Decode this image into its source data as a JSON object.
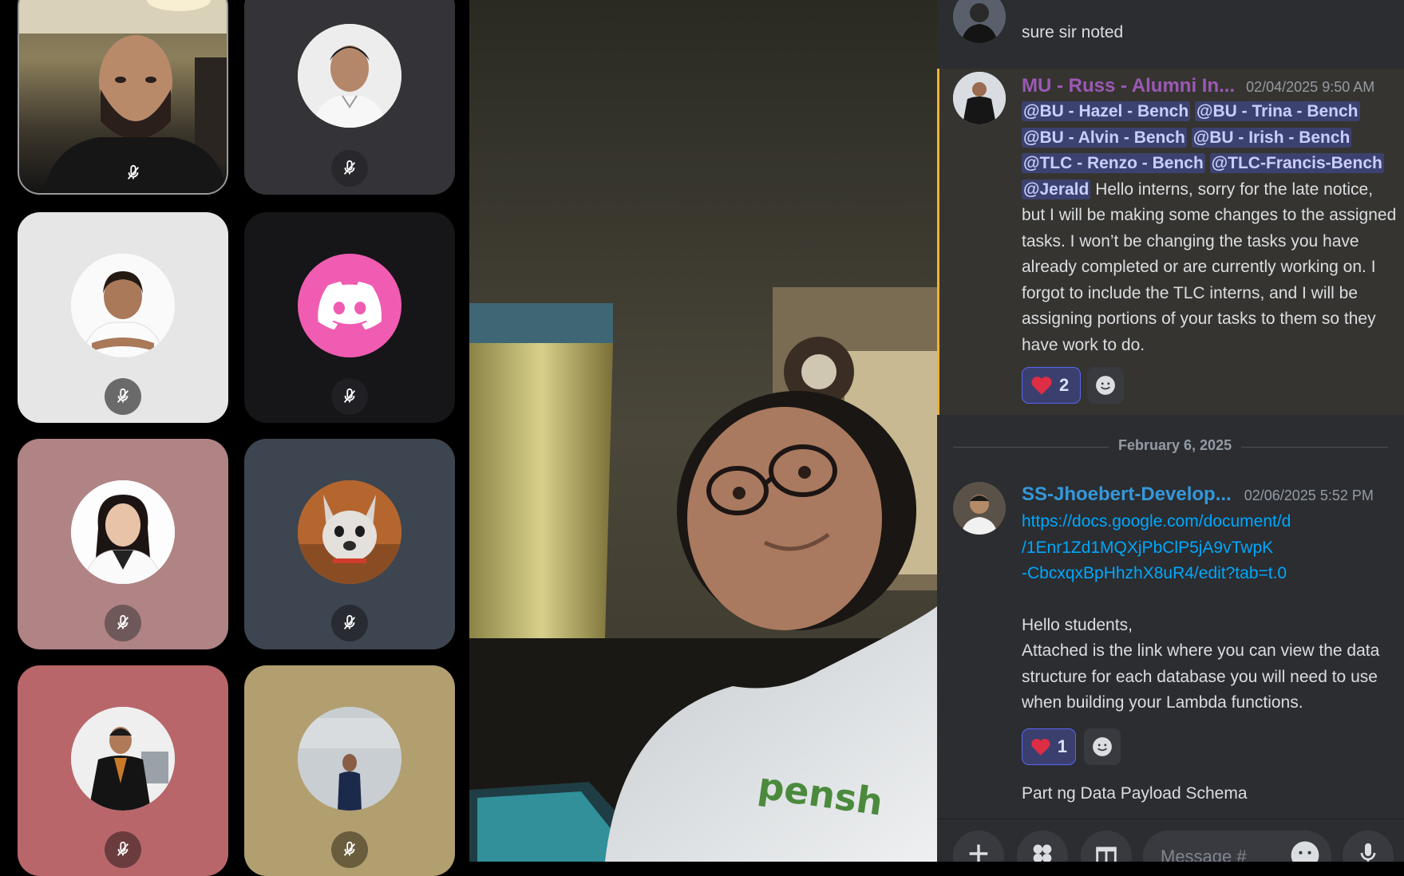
{
  "participants": [
    {
      "id": "p1",
      "muted": true
    },
    {
      "id": "p2",
      "muted": true
    },
    {
      "id": "p3",
      "muted": true
    },
    {
      "id": "p4",
      "muted": true
    },
    {
      "id": "p5",
      "muted": true
    },
    {
      "id": "p6",
      "muted": true
    },
    {
      "id": "p7",
      "muted": true
    },
    {
      "id": "p8",
      "muted": true
    }
  ],
  "colors": {
    "mention_bg": "#3c4270",
    "link": "#00a8fc",
    "author_russ": "#9b59b6",
    "author_jhoebert": "#3498db",
    "heart": "#dd2e44",
    "tile_pink": "#f05cb2"
  },
  "chat": {
    "prev_message": "sure sir noted",
    "msg1": {
      "author": "MU - Russ - Alumni In...",
      "timestamp": "02/04/2025 9:50 AM",
      "mentions": [
        "@BU - Hazel - Bench",
        "@BU - Trina - Bench",
        "@BU - Alvin - Bench",
        "@BU - Irish - Bench",
        "@TLC - Renzo - Bench",
        "@TLC-Francis-Bench",
        "@Jerald"
      ],
      "body": "Hello interns, sorry for the late notice, but I will be making some changes to the assigned tasks. I won’t be changing the tasks you have already completed or are currently working on. I forgot to include the TLC interns, and I will be assigning portions of your tasks to them so they have work to do.",
      "reaction_count": "2"
    },
    "date_divider": "February 6, 2025",
    "msg2": {
      "author": "SS-Jhoebert-Develop...",
      "timestamp": "02/06/2025 5:52 PM",
      "link_lines": [
        "https://docs.google.com/document/d",
        "/1Enr1Zd1MQXjPbClP5jA9vTwpK",
        "-CbcxqxBpHhzhX8uR4/edit?tab=t.0"
      ],
      "greeting": "Hello students,",
      "body": "Attached is the link where you can view the data structure for each database you will need to use when building your Lambda functions.",
      "reaction_count": "1"
    },
    "partial_message": "Part ng Data Payload Schema",
    "composer": {
      "placeholder": "Message #"
    }
  }
}
